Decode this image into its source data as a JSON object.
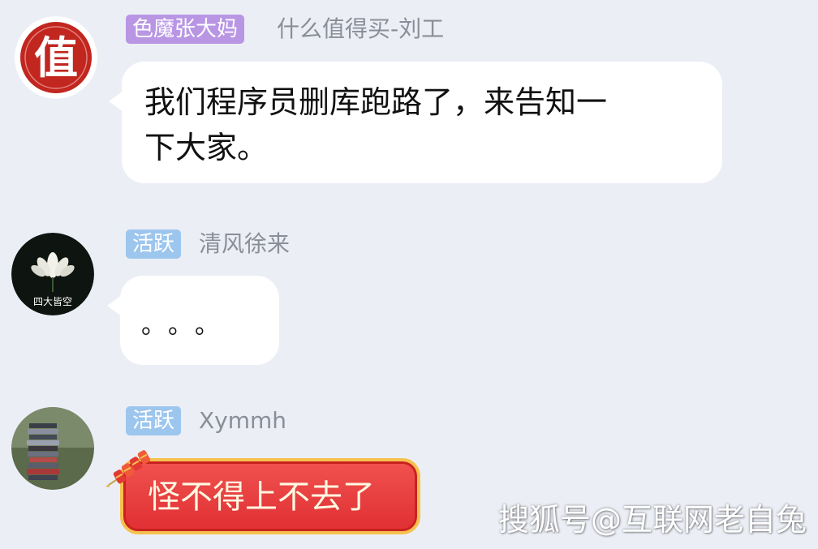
{
  "messages": [
    {
      "badge": "色魔张大妈",
      "sender": "什么值得买-刘工",
      "avatar_text": "值",
      "text_line1": "我们程序员删库跑路了，来告知一",
      "text_line2": "下大家。"
    },
    {
      "badge": "活跃",
      "sender": "清风徐来",
      "avatar_text": "四大皆空",
      "text": "。。。"
    },
    {
      "badge": "活跃",
      "sender": "Xymmh",
      "text": "怪不得上不去了"
    }
  ],
  "watermark": "搜狐号@互联网老自兔",
  "colors": {
    "background": "#eceef6",
    "badge_purple": "#b896e4",
    "badge_blue": "#9cc6ee",
    "red_bubble": "#e02f34",
    "avatar_seal_red": "#c1261f"
  },
  "icons": {
    "avatar1": "seal-zhi-icon",
    "avatar2": "lotus-icon",
    "avatar3": "bookstack-photo-icon",
    "decoration": "firecracker-icon"
  }
}
